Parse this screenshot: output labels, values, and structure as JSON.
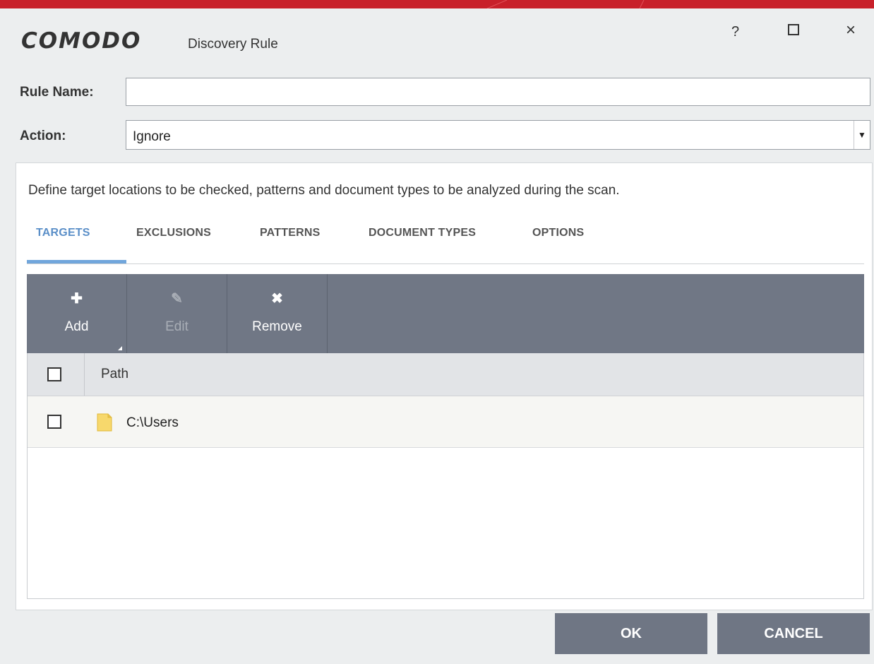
{
  "window": {
    "brand": "COMODO",
    "title": "Discovery Rule",
    "help_label": "?",
    "close_label": "×"
  },
  "form": {
    "rule_name_label": "Rule Name:",
    "rule_name_value": "",
    "action_label": "Action:",
    "action_value": "Ignore",
    "action_arrow": "▼"
  },
  "panel": {
    "description": "Define target locations to be checked, patterns and document types to be analyzed during the scan.",
    "tabs": [
      {
        "label": "TARGETS",
        "active": true
      },
      {
        "label": "EXCLUSIONS",
        "active": false
      },
      {
        "label": "PATTERNS",
        "active": false
      },
      {
        "label": "DOCUMENT TYPES",
        "active": false
      },
      {
        "label": "OPTIONS",
        "active": false
      }
    ]
  },
  "toolbar": {
    "add": {
      "label": "Add",
      "icon": "plus-icon",
      "glyph": "✚",
      "enabled": true
    },
    "edit": {
      "label": "Edit",
      "icon": "pencil-icon",
      "glyph": "✎",
      "enabled": false
    },
    "remove": {
      "label": "Remove",
      "icon": "x-icon",
      "glyph": "✖",
      "enabled": true
    }
  },
  "grid": {
    "columns": [
      "Path"
    ],
    "rows": [
      {
        "path": "C:\\Users",
        "icon": "folder-icon",
        "checked": false
      }
    ]
  },
  "buttons": {
    "ok": "OK",
    "cancel": "CANCEL"
  },
  "colors": {
    "titlebar_accent": "#c8202a",
    "toolbar_bg": "#707785",
    "active_tab": "#5b8fc8",
    "button_bg": "#6f7684"
  }
}
